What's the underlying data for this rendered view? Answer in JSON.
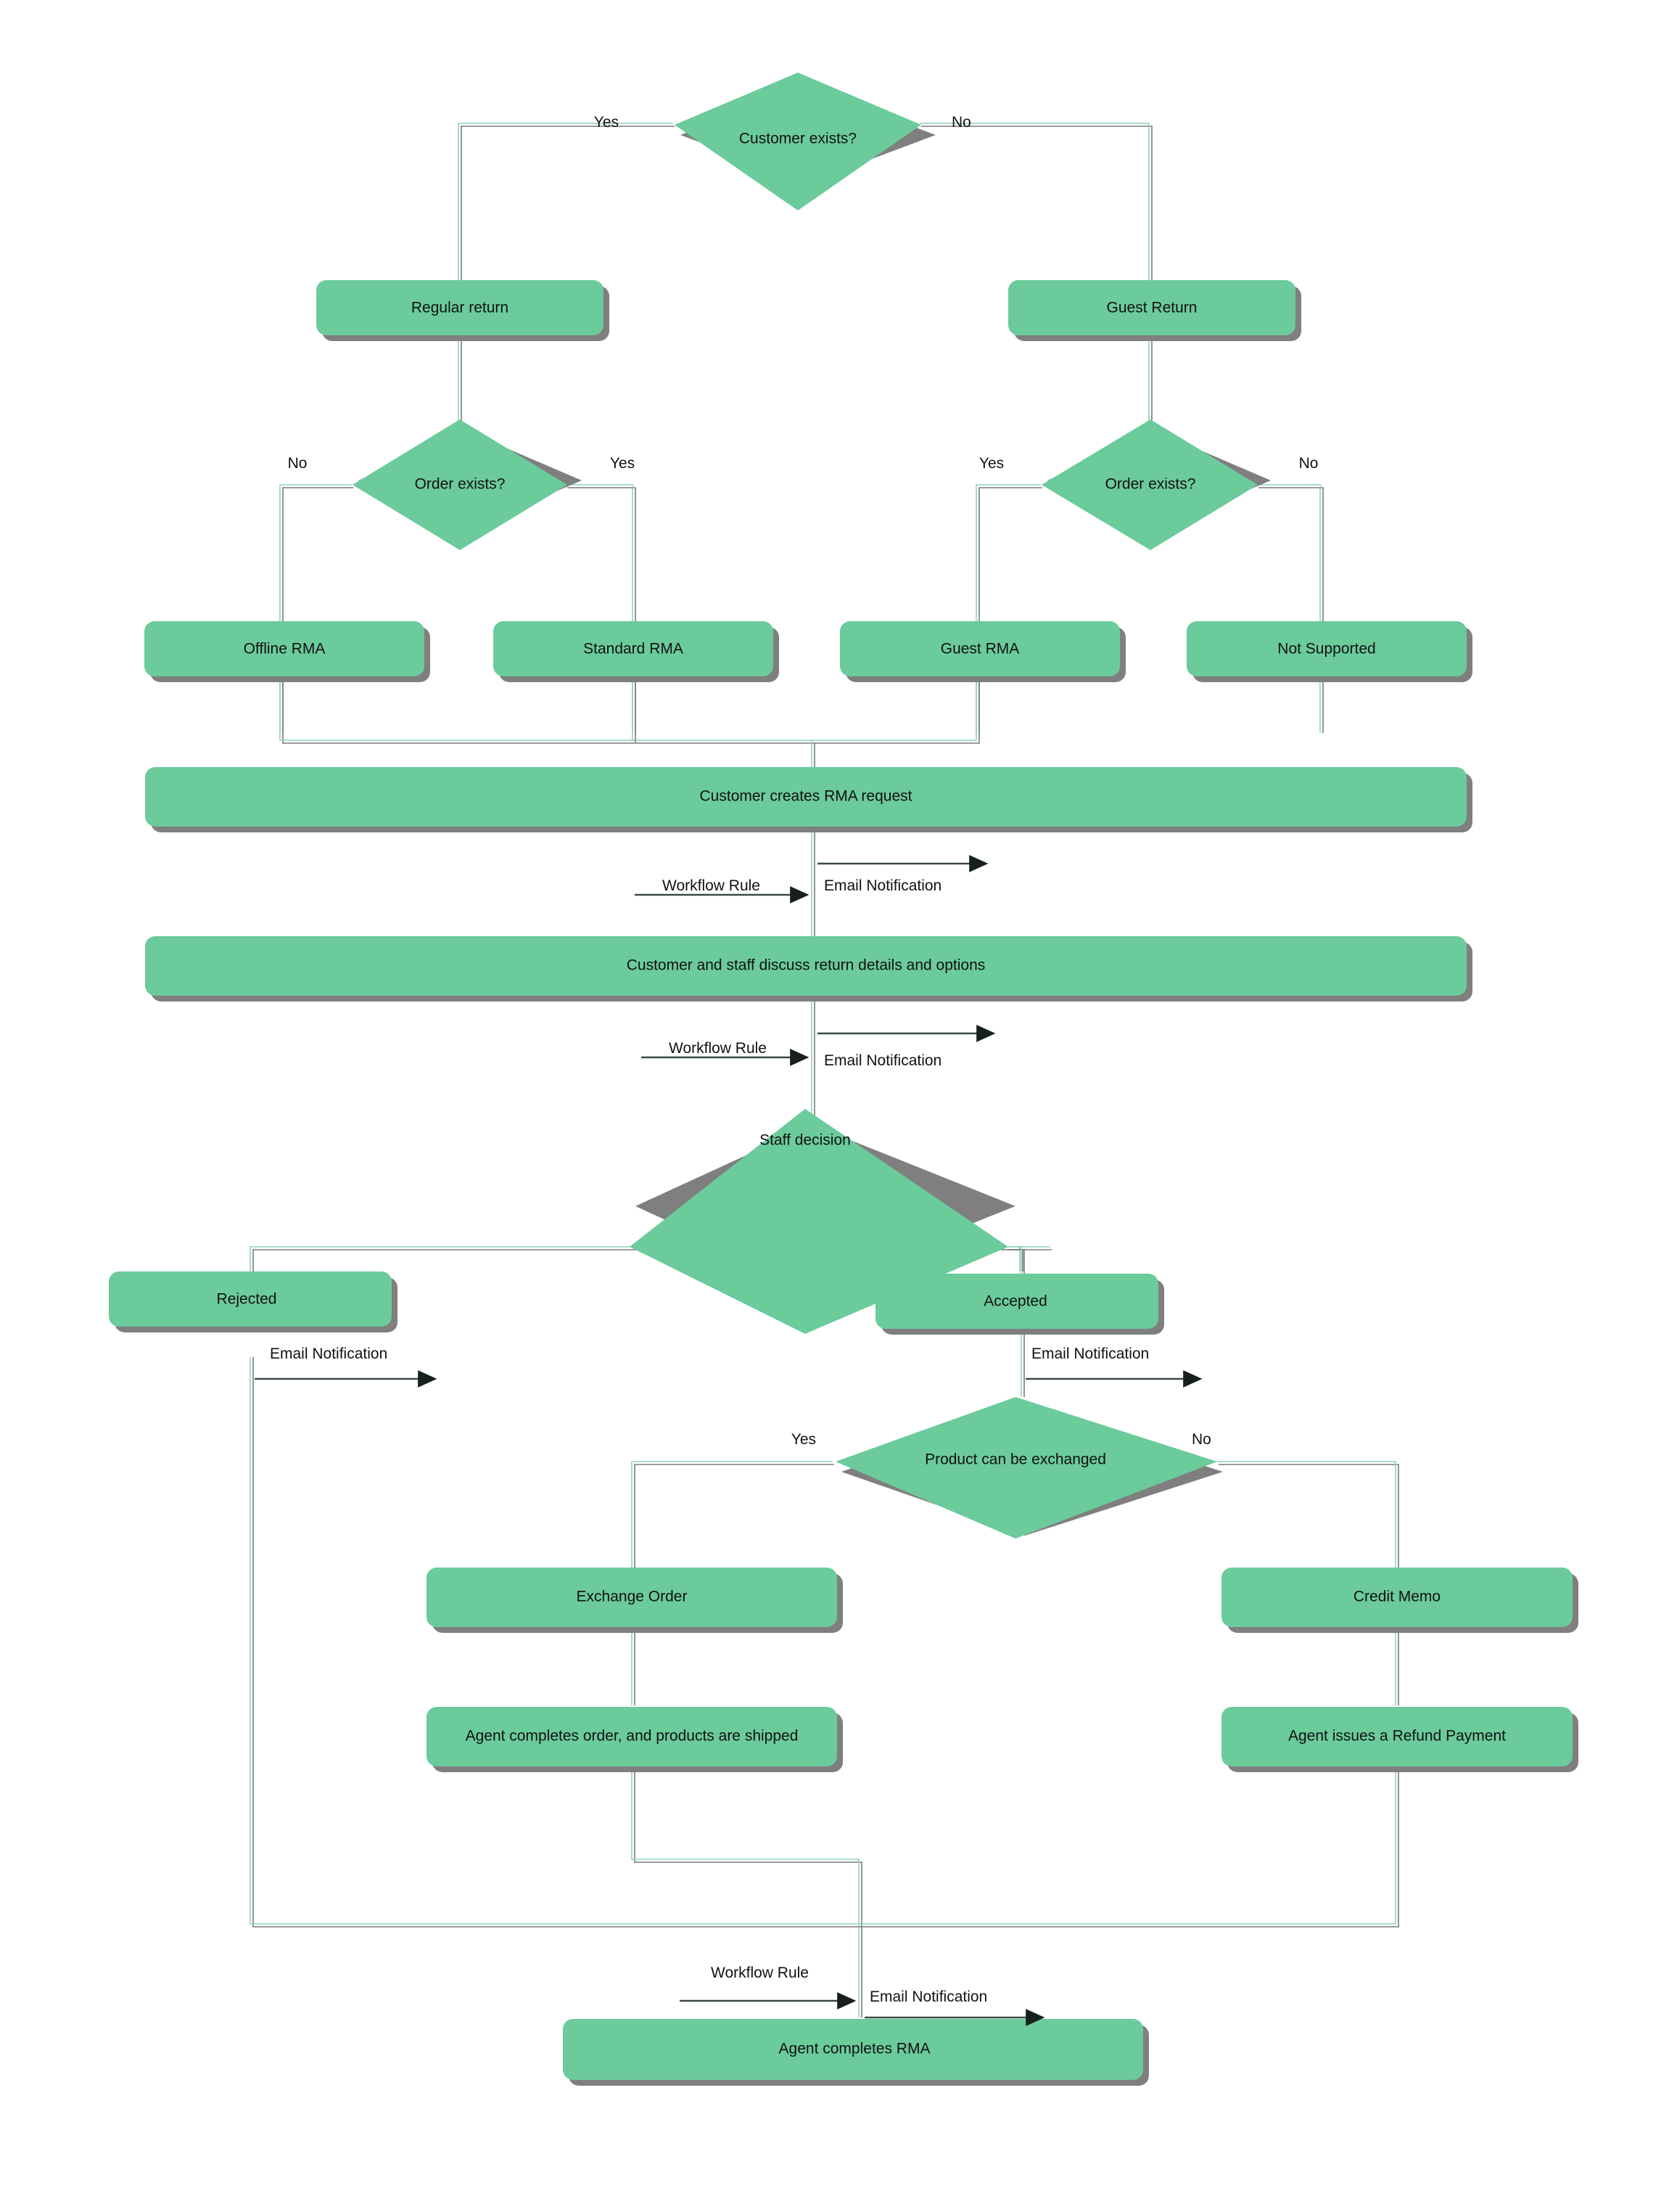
{
  "diagram": {
    "title": "RMA Return Workflow Flowchart",
    "colors": {
      "node_fill": "#6BCB9B",
      "node_shadow": "#7F7F7F",
      "connector_green": "#8FD3B4",
      "connector_gray": "#7A7A7A",
      "arrow": "#3B4A42",
      "text": "#111111",
      "background": "#FFFFFF"
    },
    "nodes": {
      "customer_exists": "Customer exists?",
      "regular_return": "Regular return",
      "guest_return": "Guest Return",
      "order_exists_left": "Order exists?",
      "order_exists_right": "Order exists?",
      "offline_rma": "Offline RMA",
      "standard_rma": "Standard RMA",
      "guest_rma": "Guest RMA",
      "not_supported": "Not Supported",
      "creates_request": "Customer creates RMA request",
      "discuss_details": "Customer and staff discuss return details and options",
      "staff_decision": "Staff decision",
      "rejected": "Rejected",
      "accepted": "Accepted",
      "can_exchange": "Product can be exchanged",
      "exchange_order": "Exchange Order",
      "credit_memo": "Credit Memo",
      "completes_order": "Agent completes order, and products are shipped",
      "refund_payment": "Agent issues a Refund Payment",
      "completes_rma": "Agent completes RMA"
    },
    "edge_labels": {
      "yes_1": "Yes",
      "no_1": "No",
      "no_2": "No",
      "yes_2": "Yes",
      "yes_3": "Yes",
      "no_3": "No",
      "workflow_rule_1": "Workflow Rule",
      "email_notification_1": "Email Notification",
      "workflow_rule_2": "Workflow Rule",
      "email_notification_2": "Email Notification",
      "email_notification_rejected": "Email Notification",
      "email_notification_accepted": "Email Notification",
      "yes_4": "Yes",
      "no_4": "No",
      "workflow_rule_3": "Workflow Rule",
      "email_notification_3": "Email Notification"
    }
  }
}
